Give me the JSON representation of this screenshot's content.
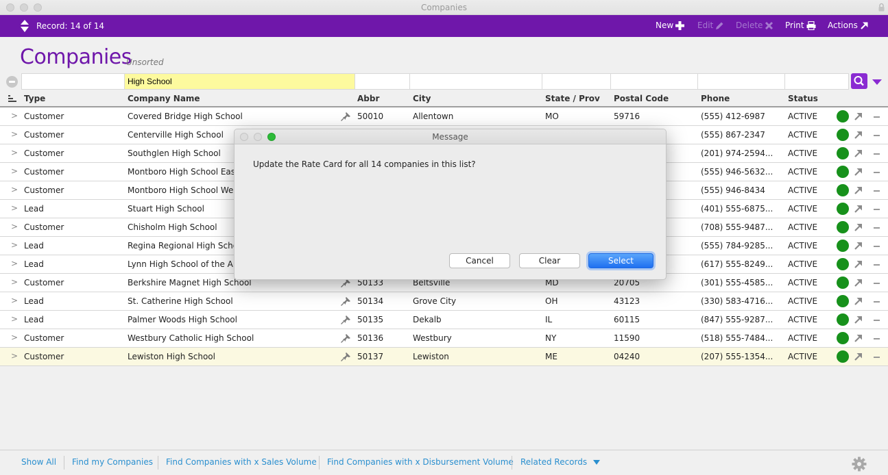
{
  "window": {
    "title": "Companies"
  },
  "toolbar": {
    "record_label": "Record: 14 of 14",
    "new_label": "New",
    "edit_label": "Edit",
    "delete_label": "Delete",
    "print_label": "Print",
    "actions_label": "Actions"
  },
  "header": {
    "title": "Companies",
    "sort_status": "Unsorted"
  },
  "find": {
    "fields": [
      "",
      "High School",
      "",
      "",
      "",
      "",
      "",
      ""
    ]
  },
  "columns": [
    "Type",
    "Company Name",
    "Abbr",
    "City",
    "State / Prov",
    "Postal Code",
    "Phone",
    "Status"
  ],
  "rows": [
    {
      "type": "Customer",
      "name": "Covered Bridge High School",
      "abbr": "50010",
      "city": "Allentown",
      "state": "MO",
      "postal": "59716",
      "phone": "(555) 412-6987",
      "status": "ACTIVE"
    },
    {
      "type": "Customer",
      "name": "Centerville High School",
      "abbr": "",
      "city": "",
      "state": "",
      "postal": "",
      "phone": "(555) 867-2347",
      "status": "ACTIVE"
    },
    {
      "type": "Customer",
      "name": "Southglen High School",
      "abbr": "",
      "city": "",
      "state": "",
      "postal": "",
      "phone": "(201) 974-2594...",
      "status": "ACTIVE"
    },
    {
      "type": "Customer",
      "name": "Montboro High School East",
      "abbr": "",
      "city": "",
      "state": "",
      "postal": "",
      "phone": "(555) 946-5632...",
      "status": "ACTIVE"
    },
    {
      "type": "Customer",
      "name": "Montboro High School Wes",
      "abbr": "",
      "city": "",
      "state": "",
      "postal": "",
      "phone": "(555) 946-8434",
      "status": "ACTIVE"
    },
    {
      "type": "Lead",
      "name": "Stuart High School",
      "abbr": "",
      "city": "",
      "state": "",
      "postal": "",
      "phone": "(401) 555-6875...",
      "status": "ACTIVE"
    },
    {
      "type": "Customer",
      "name": "Chisholm High School",
      "abbr": "",
      "city": "",
      "state": "",
      "postal": "",
      "phone": "(708) 555-9487...",
      "status": "ACTIVE"
    },
    {
      "type": "Lead",
      "name": "Regina Regional High Scho",
      "abbr": "",
      "city": "",
      "state": "",
      "postal": "",
      "phone": "(555) 784-9285...",
      "status": "ACTIVE"
    },
    {
      "type": "Lead",
      "name": "Lynn High School of the Art",
      "abbr": "",
      "city": "",
      "state": "",
      "postal": "",
      "phone": "(617) 555-8249...",
      "status": "ACTIVE"
    },
    {
      "type": "Customer",
      "name": "Berkshire Magnet High School",
      "abbr": "50133",
      "city": "Beltsville",
      "state": "MD",
      "postal": "20705",
      "phone": "(301) 555-4585...",
      "status": "ACTIVE"
    },
    {
      "type": "Lead",
      "name": "St. Catherine High School",
      "abbr": "50134",
      "city": "Grove City",
      "state": "OH",
      "postal": "43123",
      "phone": "(330) 583-4716...",
      "status": "ACTIVE"
    },
    {
      "type": "Lead",
      "name": "Palmer Woods High School",
      "abbr": "50135",
      "city": "Dekalb",
      "state": "IL",
      "postal": "60115",
      "phone": "(847) 555-9287...",
      "status": "ACTIVE"
    },
    {
      "type": "Customer",
      "name": "Westbury Catholic High School",
      "abbr": "50136",
      "city": "Westbury",
      "state": "NY",
      "postal": "11590",
      "phone": "(518) 555-7484...",
      "status": "ACTIVE"
    },
    {
      "type": "Customer",
      "name": "Lewiston High School",
      "abbr": "50137",
      "city": "Lewiston",
      "state": "ME",
      "postal": "04240",
      "phone": "(207) 555-1354...",
      "status": "ACTIVE"
    }
  ],
  "current_row_index": 13,
  "status_color": "#17911b",
  "footer": {
    "links": [
      "Show All",
      "Find my Companies",
      "Find Companies with x Sales Volume",
      "Find Companies with x Disbursement Volume",
      "Related Records"
    ]
  },
  "dialog": {
    "title": "Message",
    "message": "Update the Rate Card for all 14 companies in this list?",
    "cancel_label": "Cancel",
    "clear_label": "Clear",
    "select_label": "Select"
  }
}
